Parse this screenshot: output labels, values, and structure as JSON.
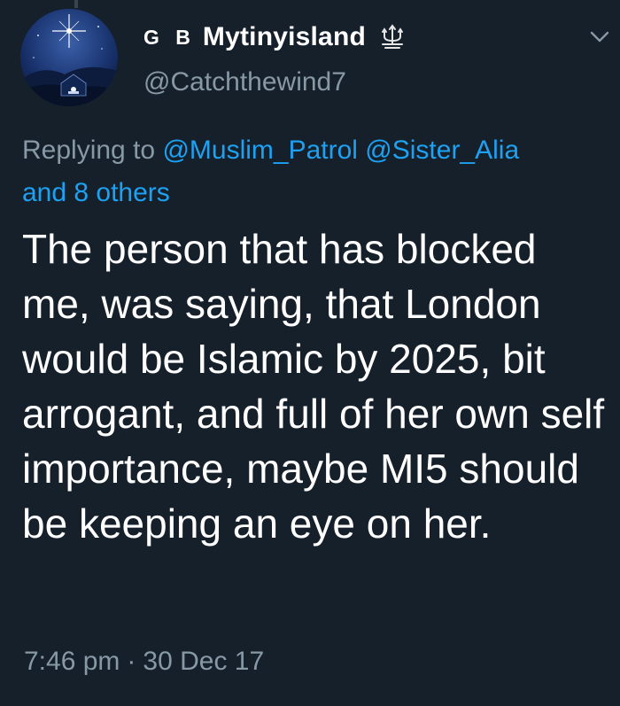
{
  "user": {
    "prefix_letters": "G B",
    "display_name": "Mytinyisland",
    "badge_icon": "trident-crown-icon",
    "handle": "@Catchthewind7",
    "avatar_icon": "night-sky-avatar"
  },
  "reply": {
    "prefix": "Replying to",
    "mentions": [
      "@Muslim_Patrol",
      "@Sister_Alia"
    ],
    "others": "and 8 others"
  },
  "tweet": {
    "text": "The person that has blocked me, was saying, that London would be Islamic by 2025, bit arrogant, and full of her own self importance, maybe MI5 should be keeping an eye on her."
  },
  "meta": {
    "time": "7:46 pm",
    "separator": "·",
    "date": "30 Dec 17"
  },
  "menu": {
    "icon": "chevron-down-icon"
  },
  "colors": {
    "background": "#15202b",
    "primary_text": "#ffffff",
    "secondary_text": "#8899a6",
    "link": "#1da1f2"
  }
}
